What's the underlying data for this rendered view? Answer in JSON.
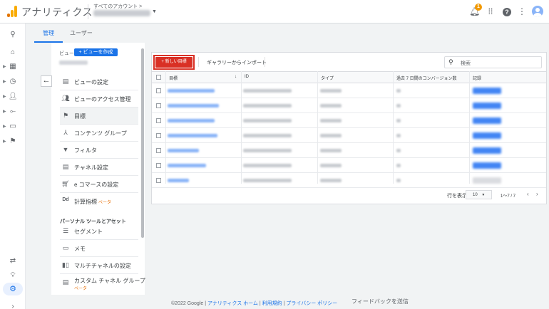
{
  "app": {
    "title": "アナリティクス",
    "account_crumb": "すべてのアカウント >",
    "notification_count": "1"
  },
  "tabs": [
    {
      "label": "管理"
    },
    {
      "label": "ユーザー"
    }
  ],
  "view": {
    "label": "ビュー",
    "create_button": "+ ビューを作成"
  },
  "settings_items": [
    {
      "label": "ビューの設定",
      "icon": "document-icon"
    },
    {
      "label": "ビューのアクセス管理",
      "icon": "people-icon"
    },
    {
      "label": "目標",
      "icon": "flag-icon"
    },
    {
      "label": "コンテンツ グループ",
      "icon": "person-tree-icon"
    },
    {
      "label": "フィルタ",
      "icon": "filter-icon"
    },
    {
      "label": "チャネル設定",
      "icon": "document-icon"
    },
    {
      "label": "e コマースの設定",
      "icon": "cart-icon"
    },
    {
      "label": "計算指標",
      "beta": "ベータ",
      "icon": "dd-icon"
    }
  ],
  "personal_tools": {
    "heading": "パーソナル ツールとアセット",
    "items": [
      {
        "label": "セグメント",
        "icon": "segment-icon"
      },
      {
        "label": "メモ",
        "icon": "comment-icon"
      },
      {
        "label": "マルチチャネルの設定",
        "icon": "bar-chart-icon"
      },
      {
        "label": "カスタム チャネル グループ",
        "sub": "ベータ",
        "icon": "document-icon"
      }
    ]
  },
  "goals": {
    "new_goal_button": "+ 新しい目標",
    "gallery_button": "ギャラリーからインポート",
    "search_placeholder": "検索",
    "columns": [
      "目標",
      "ID",
      "タイプ",
      "過去 7 日間のコンバージョン数",
      "記録"
    ],
    "row_count": 7,
    "pager_label": "行を表示",
    "pager_value": "10",
    "pager_range": "1〜7 / 7",
    "recording": [
      true,
      true,
      true,
      true,
      true,
      true,
      false
    ]
  },
  "footer": {
    "copyright": "©2022 Google",
    "links": [
      "アナリティクス ホーム",
      "利用規約",
      "プライバシー ポリシー"
    ],
    "feedback": "フィードバックを送信"
  },
  "colors": {
    "accent": "#1a73e8",
    "new_goal": "#d93025",
    "logo_orange": "#f9ab00",
    "logo_dark": "#e37400"
  }
}
